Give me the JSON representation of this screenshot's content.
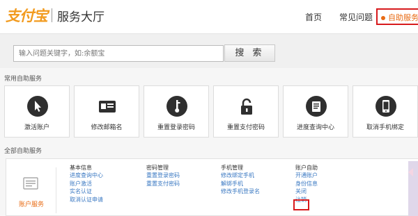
{
  "header": {
    "brand": "支付宝",
    "title": "服务大厅",
    "nav": [
      "首页",
      "常见问题"
    ],
    "self_service": "自助服务"
  },
  "search": {
    "placeholder": "输入问题关键字，如:余额宝",
    "button_label": "搜 索"
  },
  "common": {
    "title": "常用自助服务",
    "items": [
      {
        "label": "激活账户",
        "icon": "cursor-icon"
      },
      {
        "label": "修改邮箱名",
        "icon": "id-card-icon"
      },
      {
        "label": "重置登录密码",
        "icon": "key-icon"
      },
      {
        "label": "重置支付密码",
        "icon": "lock-icon"
      },
      {
        "label": "进度查询中心",
        "icon": "document-icon"
      },
      {
        "label": "取消手机绑定",
        "icon": "mobile-phone-icon"
      }
    ]
  },
  "all": {
    "title": "全部自助服务",
    "account_label": "账户服务",
    "columns": [
      {
        "head": "基本信息",
        "links": [
          "进度查询中心",
          "账户激活",
          "实名认证",
          "取消认证申请"
        ]
      },
      {
        "head": "密码管理",
        "links": [
          "重置登录密码",
          "重置支付密码"
        ]
      },
      {
        "head": "手机管理",
        "links": [
          "修改绑定手机",
          "解绑手机",
          "修改手机登录名"
        ]
      },
      {
        "head": "账户自助",
        "links": [
          "开通账户",
          "身份信息",
          "关闭",
          "注销"
        ]
      }
    ]
  },
  "colors": {
    "brand_orange": "#f29b1f",
    "highlight_red": "#d7191c",
    "link_blue": "#3a78c2"
  }
}
